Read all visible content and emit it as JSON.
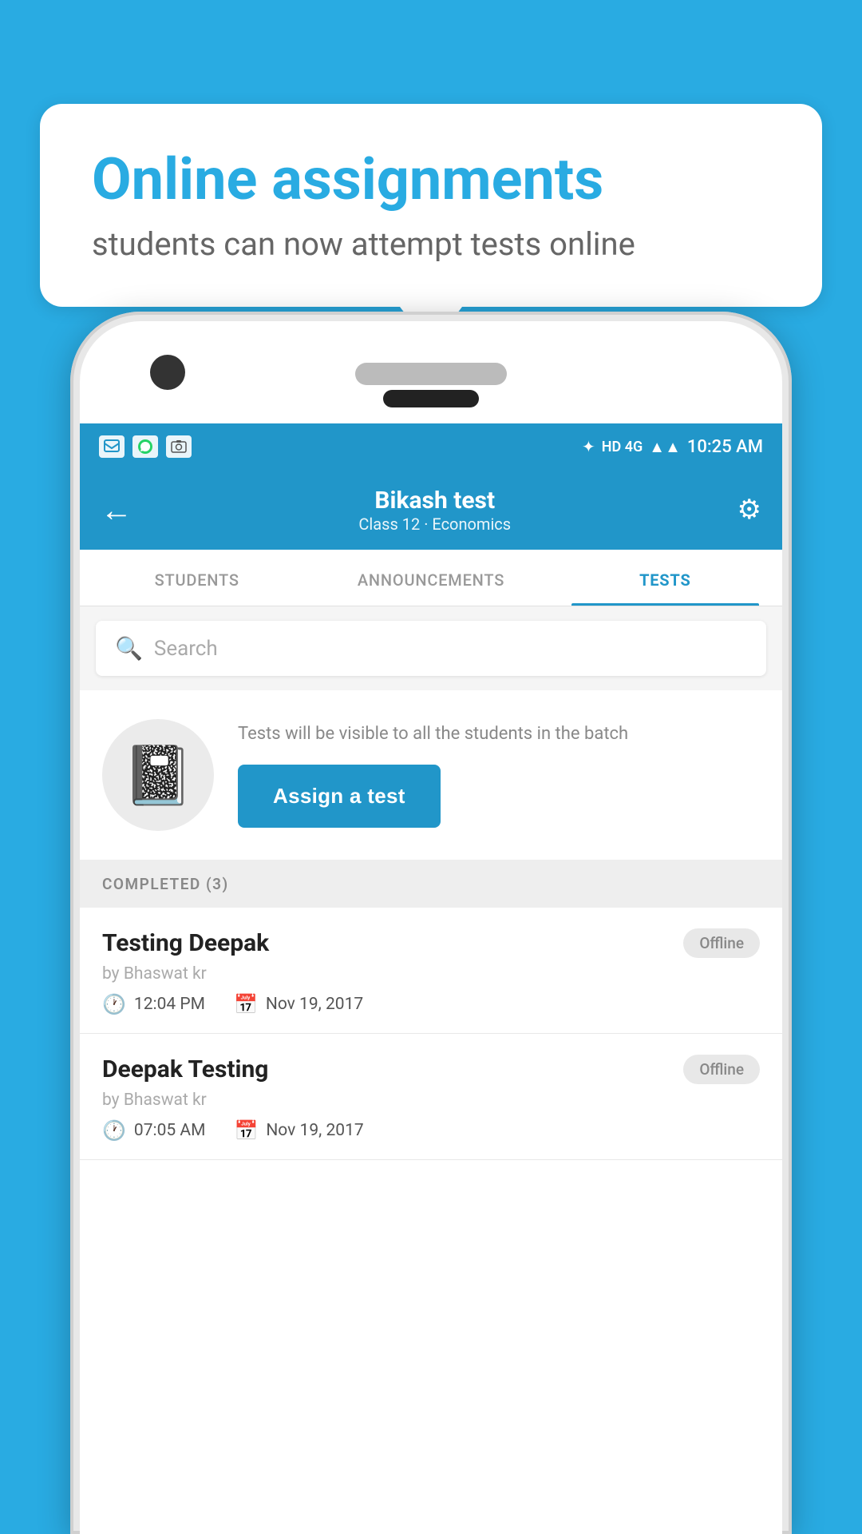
{
  "bubble": {
    "title": "Online assignments",
    "subtitle": "students can now attempt tests online"
  },
  "status_bar": {
    "time": "10:25 AM",
    "network": "HD 4G"
  },
  "app_bar": {
    "title": "Bikash test",
    "subtitle": "Class 12 · Economics",
    "back_label": "←"
  },
  "tabs": [
    {
      "label": "STUDENTS",
      "active": false
    },
    {
      "label": "ANNOUNCEMENTS",
      "active": false
    },
    {
      "label": "TESTS",
      "active": true
    }
  ],
  "search": {
    "placeholder": "Search"
  },
  "assign_section": {
    "description": "Tests will be visible to all the students in the batch",
    "button_label": "Assign a test"
  },
  "completed": {
    "header": "COMPLETED (3)",
    "items": [
      {
        "name": "Testing Deepak",
        "author": "by Bhaswat kr",
        "time": "12:04 PM",
        "date": "Nov 19, 2017",
        "badge": "Offline"
      },
      {
        "name": "Deepak Testing",
        "author": "by Bhaswat kr",
        "time": "07:05 AM",
        "date": "Nov 19, 2017",
        "badge": "Offline"
      }
    ]
  }
}
